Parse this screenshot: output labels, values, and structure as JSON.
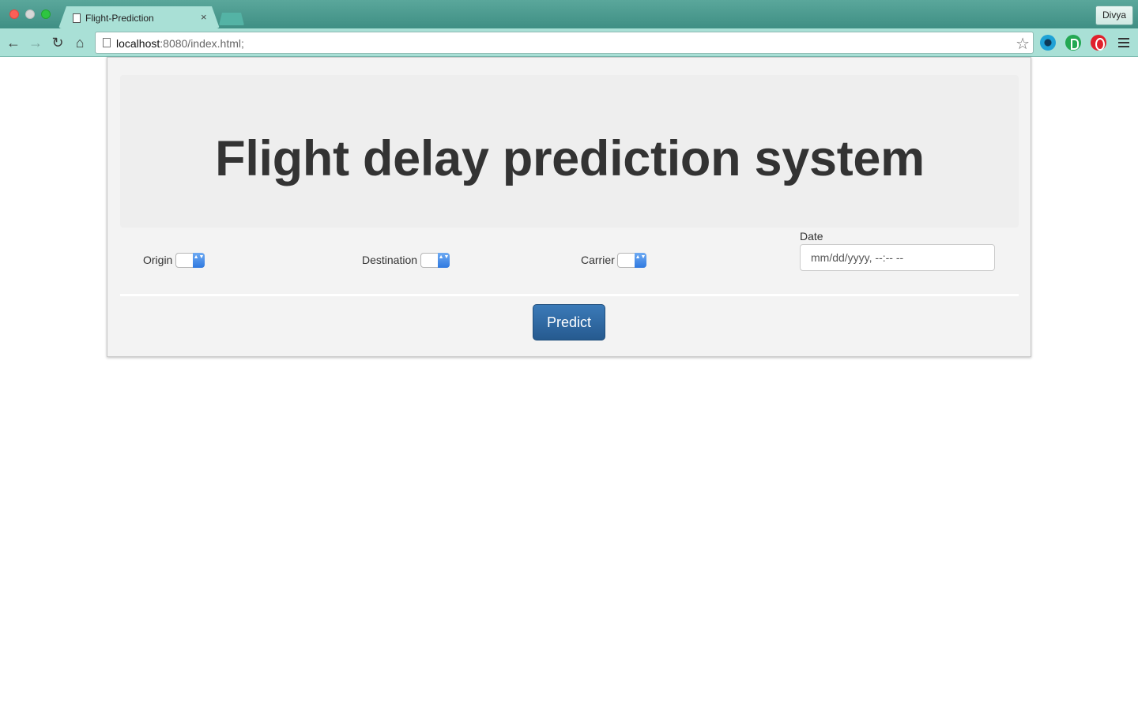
{
  "browser": {
    "tab_title": "Flight-Prediction",
    "tab_close": "×",
    "profile_name": "Divya",
    "url_host": "localhost",
    "url_path": ":8080/index.html;",
    "icons": {
      "back": "←",
      "forward": "→",
      "reload": "↻",
      "home": "⌂",
      "star": "☆"
    }
  },
  "page": {
    "title": "Flight delay prediction system",
    "form": {
      "origin_label": "Origin",
      "destination_label": "Destination",
      "carrier_label": "Carrier",
      "date_label": "Date",
      "date_placeholder": "mm/dd/yyyy, --:-- --",
      "select_arrow": "▲▼"
    },
    "predict_label": "Predict"
  }
}
